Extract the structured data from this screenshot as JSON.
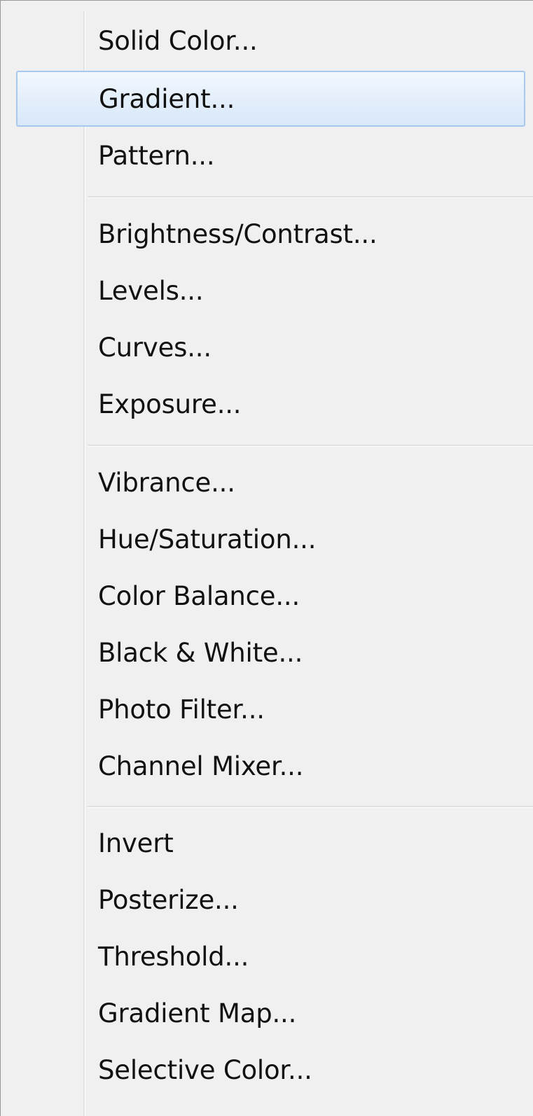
{
  "menu": {
    "items": [
      {
        "label": "Solid Color..."
      },
      {
        "label": "Gradient...",
        "highlighted": true
      },
      {
        "label": "Pattern..."
      },
      {
        "label": "Brightness/Contrast..."
      },
      {
        "label": "Levels..."
      },
      {
        "label": "Curves..."
      },
      {
        "label": "Exposure..."
      },
      {
        "label": "Vibrance..."
      },
      {
        "label": "Hue/Saturation..."
      },
      {
        "label": "Color Balance..."
      },
      {
        "label": "Black & White..."
      },
      {
        "label": "Photo Filter..."
      },
      {
        "label": "Channel Mixer..."
      },
      {
        "label": "Invert"
      },
      {
        "label": "Posterize..."
      },
      {
        "label": "Threshold..."
      },
      {
        "label": "Gradient Map..."
      },
      {
        "label": "Selective Color..."
      }
    ],
    "colors": {
      "background": "#f0f0f0",
      "highlight_border": "#a8c8ee",
      "highlight_fill": "#e4effb",
      "text": "#111111"
    }
  }
}
